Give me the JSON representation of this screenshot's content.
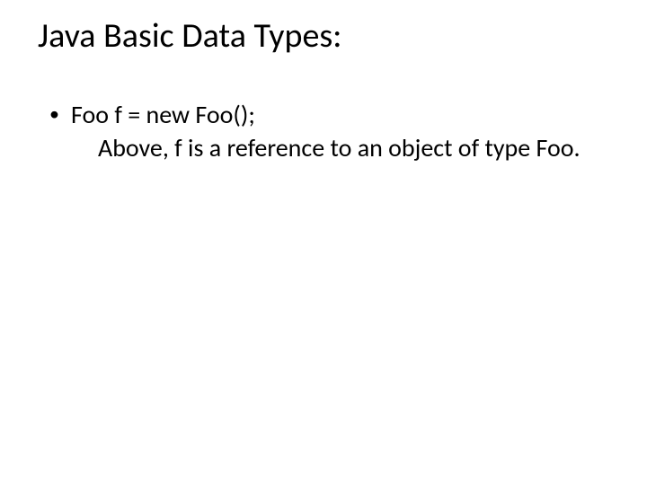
{
  "slide": {
    "title": "Java Basic Data Types:",
    "bullets": [
      {
        "marker": "•",
        "text": "Foo f = new Foo();",
        "sub": "Above, f is a reference to an object of type Foo."
      }
    ]
  }
}
